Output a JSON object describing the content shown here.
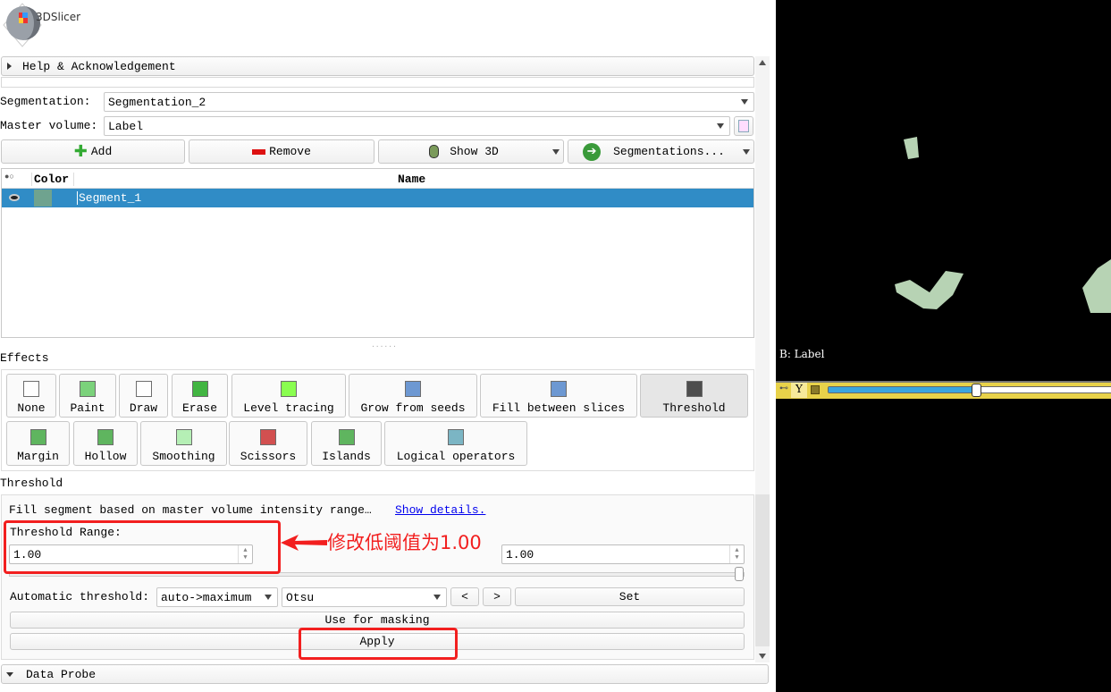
{
  "app": {
    "logo_text": "3DSlicer"
  },
  "help_section": {
    "label": "Help & Acknowledgement"
  },
  "segmentation": {
    "label": "Segmentation:",
    "value": "Segmentation_2"
  },
  "master_volume": {
    "label": "Master volume:",
    "value": "Label"
  },
  "toolbar": {
    "add": "Add",
    "remove": "Remove",
    "show3d": "Show 3D",
    "segmentations": "Segmentations..."
  },
  "table": {
    "headers": {
      "visibility": "",
      "color": "Color",
      "name": "Name"
    },
    "rows": [
      {
        "name": "Segment_1",
        "color": "#6fa38f",
        "selected": true
      }
    ]
  },
  "effects": {
    "title": "Effects",
    "items": [
      {
        "label": "None",
        "icon": "arrow-cursor-icon"
      },
      {
        "label": "Paint",
        "icon": "paint-brush-icon"
      },
      {
        "label": "Draw",
        "icon": "pencil-icon"
      },
      {
        "label": "Erase",
        "icon": "eraser-icon"
      },
      {
        "label": "Level tracing",
        "icon": "level-tracing-icon"
      },
      {
        "label": "Grow from seeds",
        "icon": "grow-seeds-icon"
      },
      {
        "label": "Fill between slices",
        "icon": "fill-slices-icon"
      },
      {
        "label": "Threshold",
        "icon": "threshold-icon",
        "active": true
      },
      {
        "label": "Margin",
        "icon": "margin-icon"
      },
      {
        "label": "Hollow",
        "icon": "hollow-icon"
      },
      {
        "label": "Smoothing",
        "icon": "smoothing-icon"
      },
      {
        "label": "Scissors",
        "icon": "scissors-icon"
      },
      {
        "label": "Islands",
        "icon": "islands-icon"
      },
      {
        "label": "Logical operators",
        "icon": "logical-operators-icon"
      }
    ]
  },
  "threshold": {
    "title": "Threshold",
    "description": "Fill segment based on master volume intensity range…",
    "show_details": "Show details.",
    "range_label": "Threshold Range:",
    "low": "1.00",
    "high": "1.00",
    "auto_label": "Automatic threshold:",
    "auto_mode": "auto->maximum",
    "auto_method": "Otsu",
    "prev": "<",
    "next": ">",
    "set": "Set",
    "use_for_masking": "Use for masking",
    "apply": "Apply"
  },
  "annotation": {
    "text": "修改低阈值为1.00",
    "color": "#f21f1f"
  },
  "data_probe": {
    "label": "Data Probe"
  },
  "slice_view": {
    "label": "B: Label",
    "slider_fraction": 0.52,
    "segment_color": "#b7d3b4",
    "bar_color": "#e8d24a"
  }
}
